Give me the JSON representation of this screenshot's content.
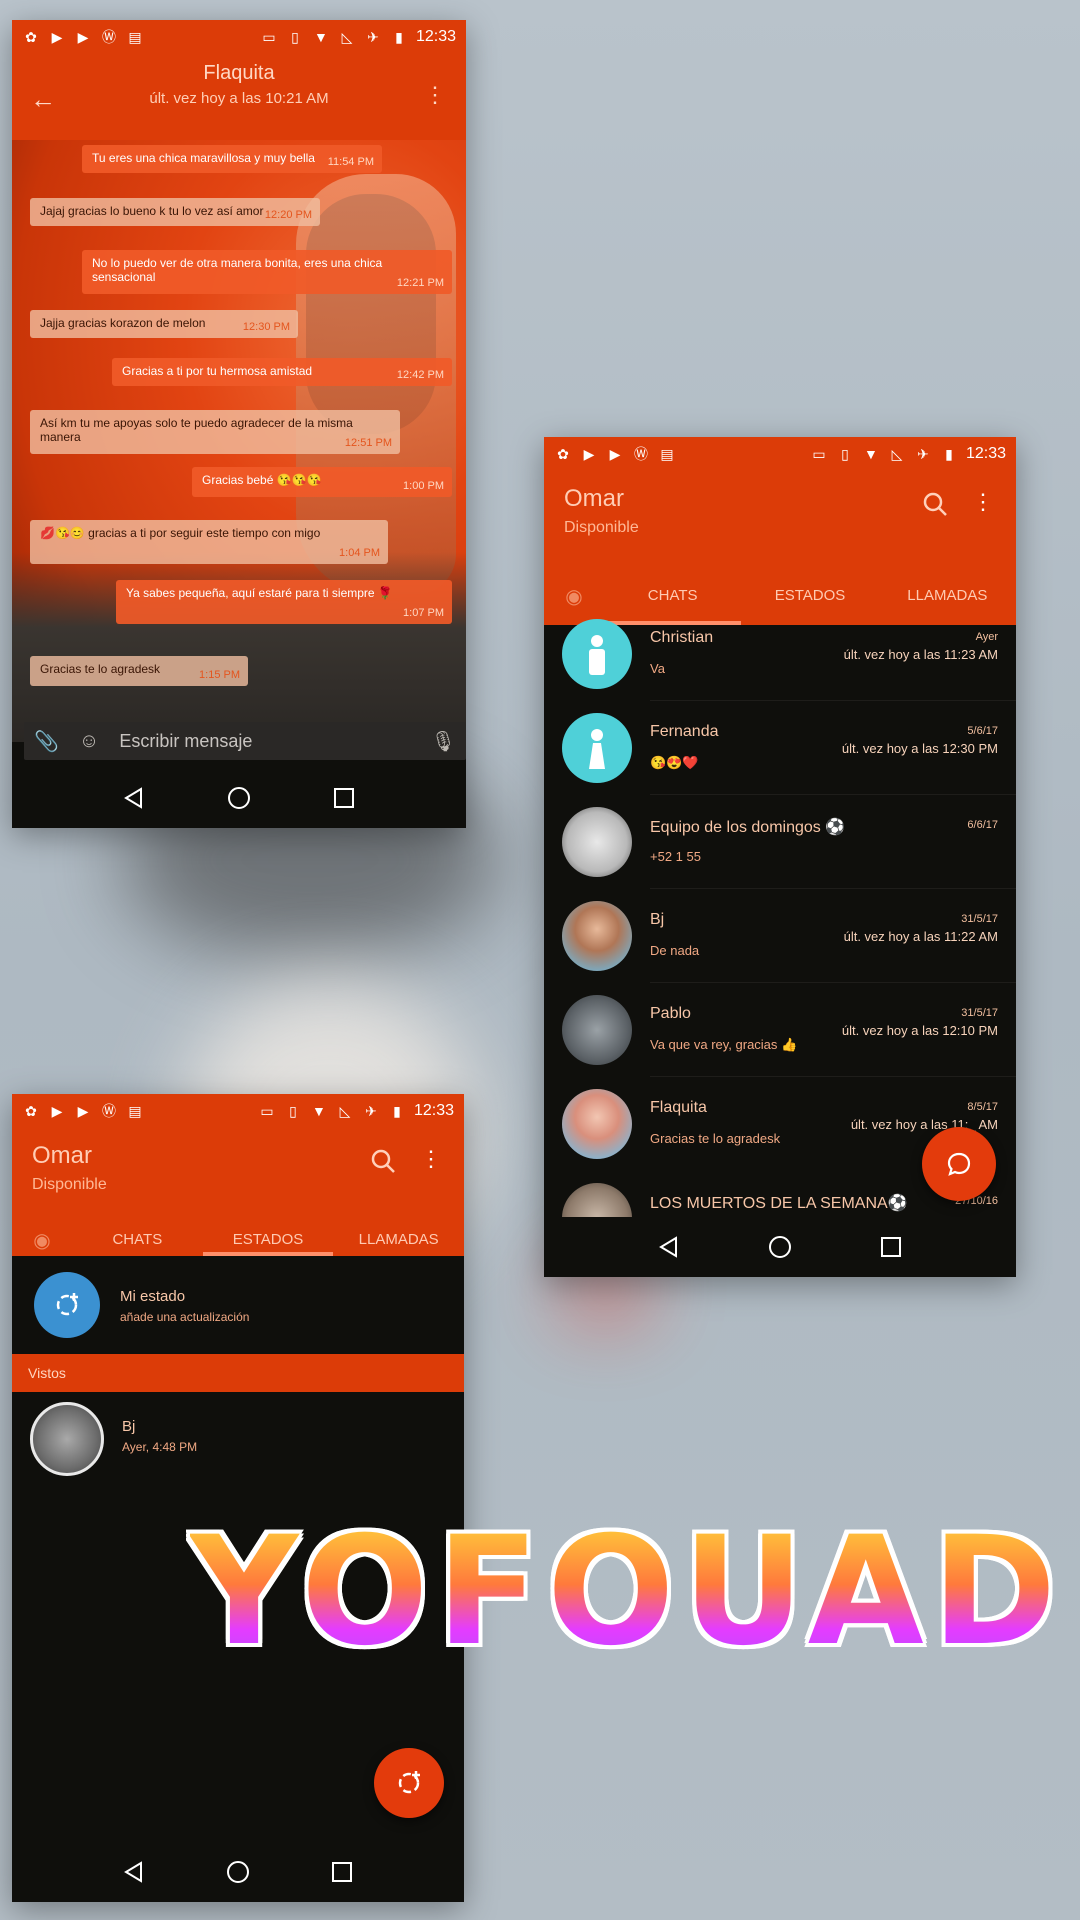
{
  "status_bar": {
    "time": "12:33"
  },
  "chat_screen": {
    "contact_name": "Flaquita",
    "last_seen": "últ. vez hoy a las 10:21 AM",
    "messages": [
      {
        "text": "Tu eres una chica maravillosa y muy bella",
        "time": "11:54 PM",
        "dir": "out"
      },
      {
        "text": "Jajaj gracias lo bueno k tu lo vez así amor",
        "time": "12:20 PM",
        "dir": "in"
      },
      {
        "text": "No lo puedo ver de otra manera bonita, eres una chica sensacional",
        "time": "12:21 PM",
        "dir": "out"
      },
      {
        "text": "Jajja gracias korazon de melon",
        "time": "12:30 PM",
        "dir": "in"
      },
      {
        "text": "Gracias a ti por tu hermosa amistad",
        "time": "12:42 PM",
        "dir": "out"
      },
      {
        "text": "Así km tu me apoyas solo te puedo agradecer de la misma manera",
        "time": "12:51 PM",
        "dir": "in"
      },
      {
        "text": "Gracias bebé 😘😘😘",
        "time": "1:00 PM",
        "dir": "out"
      },
      {
        "text": "💋😘😊 gracias a ti por seguir este tiempo con migo",
        "time": "1:04 PM",
        "dir": "in"
      },
      {
        "text": "Ya sabes pequeña, aquí estaré para ti siempre 🌹",
        "time": "1:07 PM",
        "dir": "out"
      },
      {
        "text": "Gracias te lo agradesk",
        "time": "1:15 PM",
        "dir": "in"
      }
    ],
    "input_placeholder": "Escribir mensaje"
  },
  "home_screen": {
    "user_name": "Omar",
    "user_status": "Disponible",
    "tabs": [
      "CHATS",
      "ESTADOS",
      "LLAMADAS"
    ],
    "chats": [
      {
        "name": "Christian",
        "message": "Va",
        "date": "Ayer",
        "last_seen": "últ. vez hoy a las 11:23 AM"
      },
      {
        "name": "Fernanda",
        "message": "😘😍❤️",
        "date": "5/6/17",
        "last_seen": "últ. vez hoy a las 12:30 PM"
      },
      {
        "name": "Equipo de los domingos ⚽",
        "message": "+52 1 55",
        "date": "6/6/17",
        "last_seen": ""
      },
      {
        "name": "Bj",
        "message": "De nada",
        "date": "31/5/17",
        "last_seen": "últ. vez hoy a las 11:22 AM"
      },
      {
        "name": "Pablo",
        "message": "Va que va rey, gracias 👍",
        "date": "31/5/17",
        "last_seen": "últ. vez hoy a las 12:10 PM"
      },
      {
        "name": "Flaquita",
        "message": "Gracias te lo agradesk",
        "date": "8/5/17",
        "last_seen": "últ. vez hoy a las 11:_ AM"
      },
      {
        "name": "LOS MUERTOS DE LA SEMANA⚽",
        "message": "",
        "date": "27/10/16",
        "last_seen": ""
      }
    ]
  },
  "status_screen": {
    "user_name": "Omar",
    "user_status": "Disponible",
    "tabs": [
      "CHATS",
      "ESTADOS",
      "LLAMADAS"
    ],
    "my_status_title": "Mi estado",
    "my_status_sub": "añade una actualización",
    "seen_header": "Vistos",
    "seen": [
      {
        "name": "Bj",
        "time": "Ayer, 4:48 PM"
      }
    ]
  },
  "watermark": "YOFOUAD",
  "colors": {
    "accent": "#dc3c08",
    "background": "#0f0f0c",
    "text_warm": "#f7c6a8",
    "avatar_teal": "#4fd0d8",
    "status_blue": "#3b91d1"
  }
}
